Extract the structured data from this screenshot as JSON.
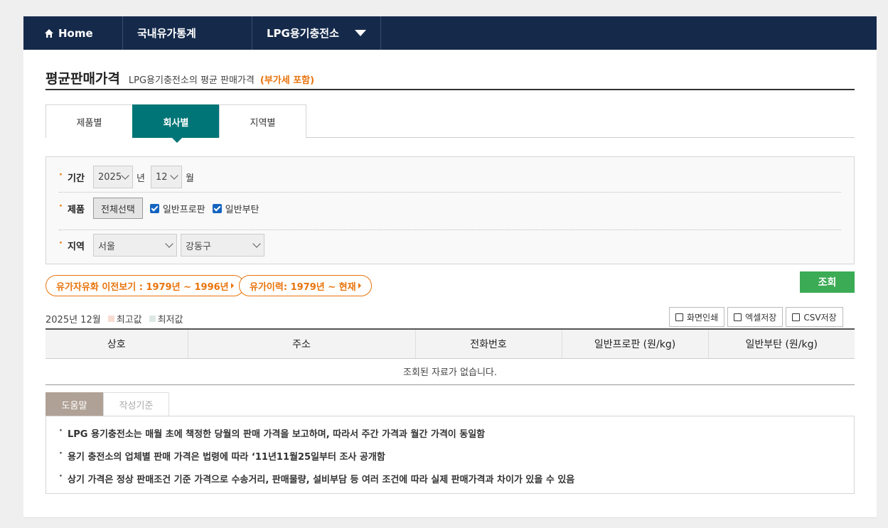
{
  "nav": {
    "home": "Home",
    "stats": "국내유가통계",
    "lpg": "LPG용기충전소"
  },
  "title": {
    "main": "평균판매가격",
    "sub": "LPG용기충전소의 평균 판매가격",
    "vat": "(부가세 포함)"
  },
  "tabs": [
    "제품별",
    "회사별",
    "지역별"
  ],
  "filters": {
    "period_label": "기간",
    "year": "2025",
    "year_unit": "년",
    "month": "12",
    "month_unit": "월",
    "product_label": "제품",
    "select_all": "전체선택",
    "product1": "일반프로판",
    "product2": "일반부탄",
    "region_label": "지역",
    "region1": "서울",
    "region2": "강동구"
  },
  "history": {
    "liberalization": "유가자유화 이전보기 : 1979년 ~ 1996년",
    "price_history": "유가이력: 1979년 ~ 현재"
  },
  "search_button": "조회",
  "meta": {
    "date": "2025년 12월",
    "max": "최고값",
    "min": "최저값",
    "max_color": "#f8dcd2",
    "min_color": "#dde8e4"
  },
  "actions": {
    "print": "화면인쇄",
    "excel": "엑셀저장",
    "csv": "CSV저장"
  },
  "table": {
    "headers": [
      "상호",
      "주소",
      "전화번호",
      "일반프로판 (원/kg)",
      "일반부탄 (원/kg)"
    ],
    "empty": "조회된 자료가 없습니다."
  },
  "help": {
    "tabs": [
      "도움말",
      "작성기준"
    ],
    "items": [
      "LPG 용기충전소는 매월 초에 책정한 당월의 판매 가격을 보고하며, 따라서 주간 가격과 월간 가격이 동일함",
      "용기 충전소의 업체별 판매 가격은 법령에 따라 ‘11년11월25일부터 조사 공개함",
      "상기 가격은 정상 판매조건 기준 가격으로 수송거리, 판매물량, 설비부담 등 여러 조건에 따라 실제 판매가격과 차이가 있을 수 있음"
    ]
  }
}
